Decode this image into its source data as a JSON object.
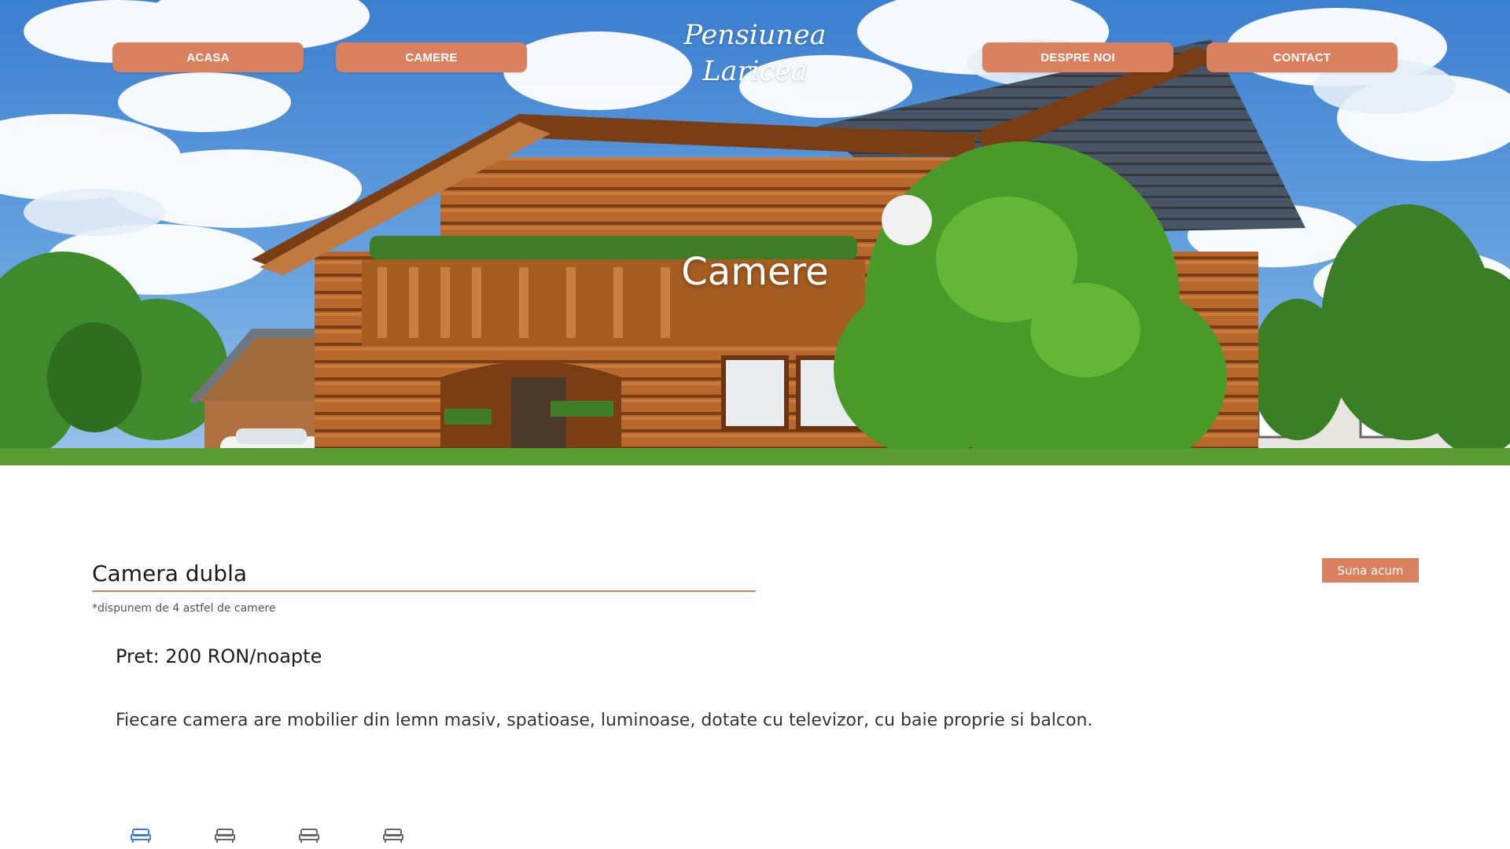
{
  "site": {
    "logo_line1": "Pensiunea",
    "logo_line2": "Laricea"
  },
  "nav": {
    "items": [
      {
        "label": "ACASA"
      },
      {
        "label": "CAMERE"
      },
      {
        "label": "DESPRE NOI"
      },
      {
        "label": "CONTACT"
      }
    ]
  },
  "hero": {
    "title": "Camere"
  },
  "room": {
    "title": "Camera dubla",
    "note": "*dispunem de 4 astfel de camere",
    "call_button": "Suna acum",
    "price": "Pret: 200 RON/noapte",
    "description": "Fiecare camera are mobilier din lemn masiv, spatioase, luminoase, dotate cu televizor, cu baie proprie si balcon."
  },
  "gallery_tabs": [
    {
      "icon": "bed-icon",
      "active": true
    },
    {
      "icon": "bed-icon",
      "active": false
    },
    {
      "icon": "bed-icon",
      "active": false
    },
    {
      "icon": "bed-icon",
      "active": false
    }
  ],
  "colors": {
    "accent": "#d9805e",
    "tab_active": "#3a7bd5",
    "tab_inactive": "#666666"
  }
}
